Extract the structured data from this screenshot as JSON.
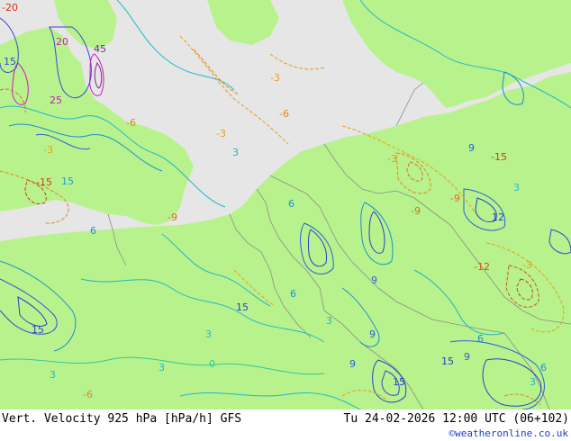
{
  "footer": {
    "title": "Vert. Velocity 925 hPa [hPa/h] GFS",
    "valid_time": "Tu 24-02-2026 12:00 UTC (06+102)",
    "credit": "©weatheronline.co.uk"
  },
  "map": {
    "land_color": "#b8f28c",
    "sea_color": "#e6e6e6",
    "border_color": "#8c8c8c",
    "contour_labels": [
      {
        "text": "15",
        "color": "#3a46d8"
      },
      {
        "text": "20",
        "color": "#c81cc0"
      },
      {
        "text": "25",
        "color": "#c81cc0"
      },
      {
        "text": "45",
        "color": "#7a2a9a"
      },
      {
        "text": "15",
        "color": "#1ea0d0"
      },
      {
        "text": "-15",
        "color": "#c84020"
      },
      {
        "text": "-20",
        "color": "#d83010"
      },
      {
        "text": "-3",
        "color": "#e2a020"
      },
      {
        "text": "-6",
        "color": "#e08a20"
      },
      {
        "text": "-9",
        "color": "#d87020"
      },
      {
        "text": "3",
        "color": "#20b8c8"
      },
      {
        "text": "6",
        "color": "#1a90d0"
      },
      {
        "text": "9",
        "color": "#2a60d8"
      },
      {
        "text": "0",
        "color": "#30c8a0"
      },
      {
        "text": "15",
        "color": "#2a40c8"
      },
      {
        "text": "-3",
        "color": "#e2a020"
      },
      {
        "text": "-6",
        "color": "#e08a20"
      },
      {
        "text": "6",
        "color": "#1a90d0"
      },
      {
        "text": "3",
        "color": "#20b8c8"
      },
      {
        "text": "-3",
        "color": "#e2a020"
      },
      {
        "text": "9",
        "color": "#2a60d8"
      },
      {
        "text": "-9",
        "color": "#d87020"
      },
      {
        "text": "-15",
        "color": "#c84020"
      },
      {
        "text": "3",
        "color": "#20b8c8"
      },
      {
        "text": "-3",
        "color": "#e2a020"
      },
      {
        "text": "15",
        "color": "#2a40c8"
      },
      {
        "text": "3",
        "color": "#20b8c8"
      },
      {
        "text": "-6",
        "color": "#e08a20"
      },
      {
        "text": "15",
        "color": "#2a40c8"
      },
      {
        "text": "9",
        "color": "#2a60d8"
      },
      {
        "text": "6",
        "color": "#1a90d0"
      },
      {
        "text": "-12",
        "color": "#d85018"
      },
      {
        "text": "-9",
        "color": "#d87020"
      },
      {
        "text": "6",
        "color": "#1a90d0"
      },
      {
        "text": "9",
        "color": "#2a60d8"
      },
      {
        "text": "12",
        "color": "#2a40c8"
      },
      {
        "text": "3",
        "color": "#20b8c8"
      },
      {
        "text": "15",
        "color": "#2a40c8"
      },
      {
        "text": "3",
        "color": "#20b8c8"
      },
      {
        "text": "6",
        "color": "#1a90d0"
      },
      {
        "text": "9",
        "color": "#2a60d8"
      },
      {
        "text": "-3",
        "color": "#e2a020"
      },
      {
        "text": "3",
        "color": "#20b8c8"
      }
    ]
  }
}
